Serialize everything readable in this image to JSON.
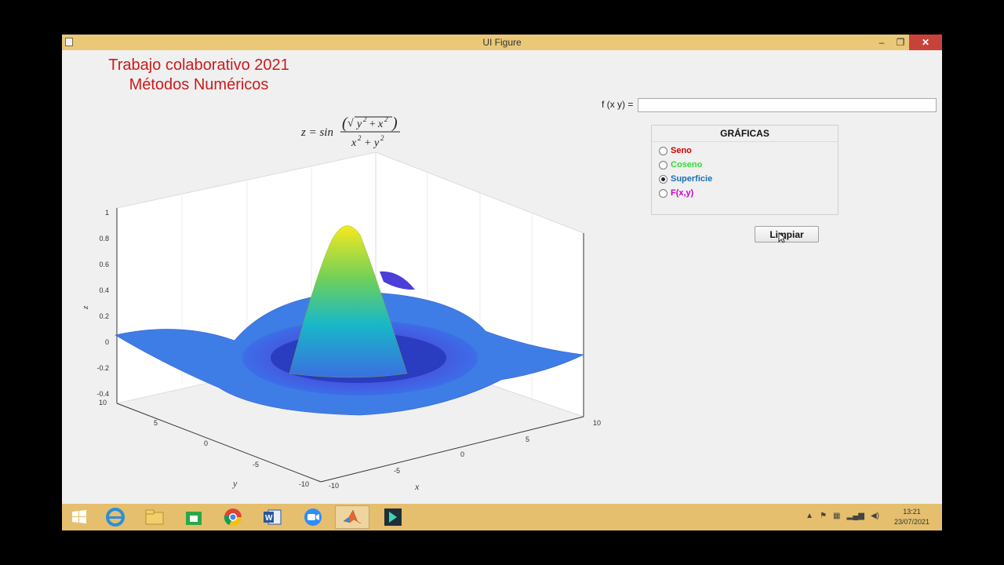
{
  "window": {
    "title": "UI Figure"
  },
  "heading": {
    "line1": "Trabajo colaborativo 2021",
    "line2": "Métodos Numéricos"
  },
  "formula": {
    "lhs": "z = sin",
    "numerator": "(√y² + x²)",
    "denominator": "x² + y²"
  },
  "fxy": {
    "label": "f (x y) =",
    "value": ""
  },
  "graficas": {
    "title": "GRÁFICAS",
    "options": [
      {
        "label": "Seno",
        "color": "#cc0000",
        "selected": false
      },
      {
        "label": "Coseno",
        "color": "#33dd33",
        "selected": false
      },
      {
        "label": "Superficie",
        "color": "#1a6fb5",
        "selected": true
      },
      {
        "label": "F(x,y)",
        "color": "#cc00cc",
        "selected": false
      }
    ]
  },
  "limpiar_label": "Limpiar",
  "plot": {
    "zlabel": "z",
    "ylabel": "y",
    "xlabel": "x",
    "z_ticks": [
      "1",
      "0.8",
      "0.6",
      "0.4",
      "0.2",
      "0",
      "-0.2",
      "-0.4"
    ],
    "y_ticks": [
      "10",
      "5",
      "0",
      "-5",
      "-10"
    ],
    "x_ticks": [
      "-10",
      "-5",
      "0",
      "5",
      "10"
    ]
  },
  "taskbar": {
    "apps": [
      "windows-start",
      "internet-explorer",
      "file-explorer",
      "store",
      "chrome",
      "word",
      "zoom",
      "matlab",
      "filmora"
    ],
    "time": "13:21",
    "date": "23/07/2021"
  }
}
